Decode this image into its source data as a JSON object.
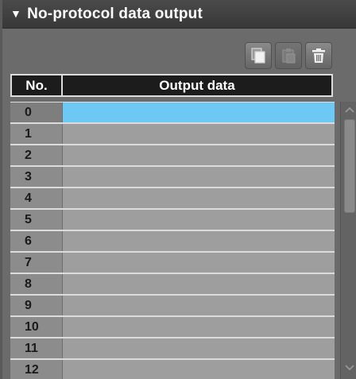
{
  "panel": {
    "title": "No-protocol data output",
    "collapse_glyph": "▼"
  },
  "toolbar": {
    "buttons": [
      {
        "icon": "copy-icon",
        "enabled": true
      },
      {
        "icon": "paste-icon",
        "enabled": false
      },
      {
        "icon": "trash-icon",
        "enabled": true
      }
    ]
  },
  "table": {
    "columns": [
      "No.",
      "Output data"
    ],
    "rows": [
      {
        "no": "0",
        "value": "",
        "selected": true
      },
      {
        "no": "1",
        "value": ""
      },
      {
        "no": "2",
        "value": ""
      },
      {
        "no": "3",
        "value": ""
      },
      {
        "no": "4",
        "value": ""
      },
      {
        "no": "5",
        "value": ""
      },
      {
        "no": "6",
        "value": ""
      },
      {
        "no": "7",
        "value": ""
      },
      {
        "no": "8",
        "value": ""
      },
      {
        "no": "9",
        "value": ""
      },
      {
        "no": "10",
        "value": ""
      },
      {
        "no": "11",
        "value": ""
      },
      {
        "no": "12",
        "value": ""
      }
    ]
  },
  "colors": {
    "selected_row": "#6ec8f4",
    "header_bg": "#383838",
    "column_header_bg": "#1c1c1c"
  }
}
